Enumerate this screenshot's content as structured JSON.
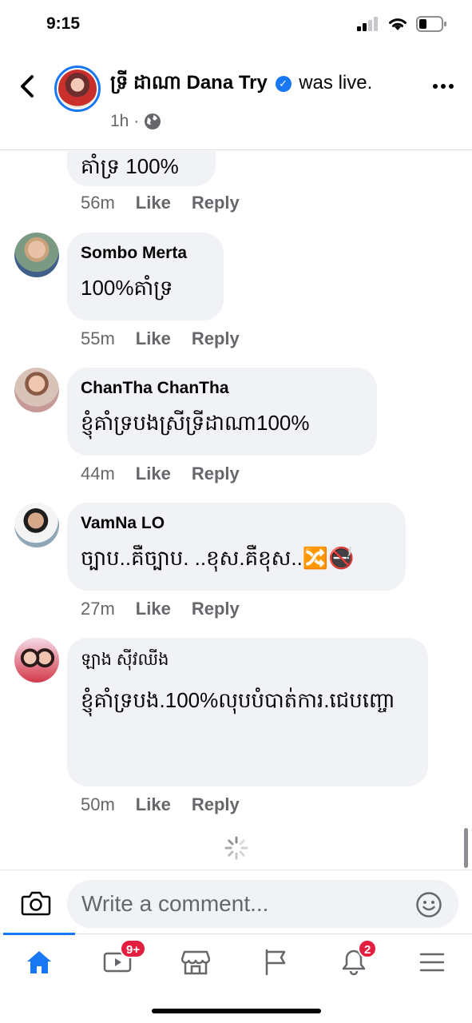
{
  "status": {
    "time": "9:15"
  },
  "header": {
    "page_name": "ទ្រី ដាណា Dana Try",
    "action": "was live.",
    "timestamp": "1h ·"
  },
  "comments": [
    {
      "author": "",
      "text": "គាំទ្រ 100%",
      "time": "56m",
      "like": "Like",
      "reply": "Reply"
    },
    {
      "author": "Sombo Merta",
      "text": "100%គាំទ្រ",
      "time": "55m",
      "like": "Like",
      "reply": "Reply"
    },
    {
      "author": "ChanTha ChanTha",
      "text": "ខ្ញុំគាំទ្របងស្រីទ្រីដាណា100%",
      "time": "44m",
      "like": "Like",
      "reply": "Reply"
    },
    {
      "author": "VamNa LO",
      "text": "ច្បាប..គឺច្បាប. ..ខុស.គឺខុស..🔀🚭",
      "time": "27m",
      "like": "Like",
      "reply": "Reply"
    },
    {
      "author": "ឡាង ស៊ីវឈីង",
      "text": "ខ្ញុំគាំទ្របង.100%លុបបំបាត់ការ.ជេបញ្ចោ",
      "time": "50m",
      "like": "Like",
      "reply": "Reply"
    }
  ],
  "composer": {
    "placeholder": "Write a comment..."
  },
  "tabbar": {
    "watch_badge": "9+",
    "notifications_badge": "2"
  },
  "colors": {
    "accent": "#1877f2",
    "bubble": "#f0f2f5",
    "badge": "#e41e3f",
    "muted": "#65676b"
  },
  "icons": [
    "back-arrow-icon",
    "verified-icon",
    "globe-icon",
    "more-icon",
    "camera-icon",
    "emoji-icon",
    "home-icon",
    "watch-icon",
    "marketplace-icon",
    "pages-flag-icon",
    "bell-icon",
    "menu-icon",
    "loading-spinner-icon"
  ]
}
